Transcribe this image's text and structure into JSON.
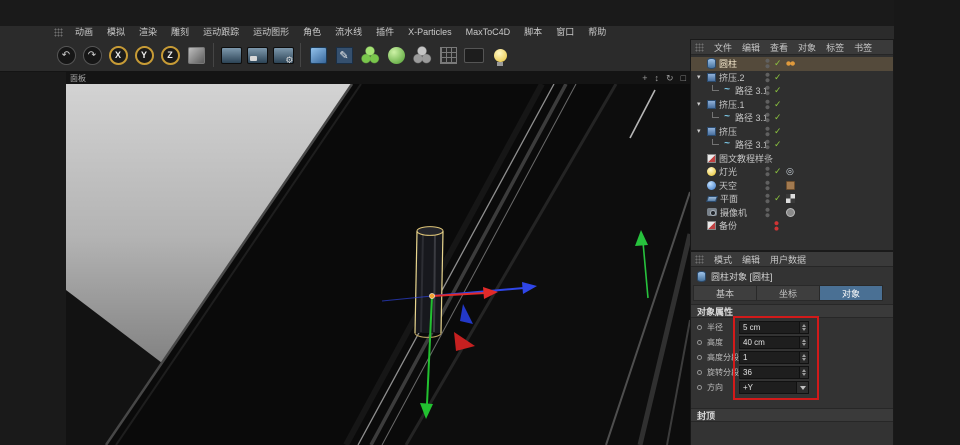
{
  "menubar": {
    "items": [
      "动画",
      "模拟",
      "渲染",
      "雕刻",
      "运动跟踪",
      "运动图形",
      "角色",
      "流水线",
      "插件",
      "X-Particles",
      "MaxToC4D",
      "脚本",
      "窗口",
      "帮助"
    ]
  },
  "toolbar": {
    "axis_lock": [
      "X",
      "Y",
      "Z"
    ]
  },
  "viewport": {
    "panel_label": "面板"
  },
  "object_manager": {
    "menu": [
      "文件",
      "编辑",
      "查看",
      "对象",
      "标签",
      "书签"
    ],
    "items": [
      {
        "label": "圆柱",
        "icon": "cylinder-icon",
        "selected": true
      },
      {
        "label": "挤压.2",
        "icon": "extrude-icon"
      },
      {
        "label": "路径 3.1",
        "icon": "spline-icon"
      },
      {
        "label": "挤压.1",
        "icon": "extrude-icon"
      },
      {
        "label": "路径 3.1",
        "icon": "spline-icon"
      },
      {
        "label": "挤压",
        "icon": "extrude-icon"
      },
      {
        "label": "路径 3.1",
        "icon": "spline-icon"
      },
      {
        "label": "图文教程样条",
        "icon": "null-icon"
      },
      {
        "label": "灯光",
        "icon": "light-icon"
      },
      {
        "label": "天空",
        "icon": "sky-icon"
      },
      {
        "label": "平面",
        "icon": "plane-icon"
      },
      {
        "label": "摄像机",
        "icon": "camera-icon"
      },
      {
        "label": "备份",
        "icon": "null-icon"
      }
    ]
  },
  "attribute_manager": {
    "menu": [
      "模式",
      "编辑",
      "用户数据"
    ],
    "object_title": "圆柱对象 [圆柱]",
    "tabs": [
      "基本",
      "坐标",
      "对象"
    ],
    "active_tab": "对象",
    "section_title": "对象属性",
    "fields": [
      {
        "label": "半径",
        "value": "5 cm"
      },
      {
        "label": "高度",
        "value": "40 cm"
      },
      {
        "label": "高度分段",
        "value": "1"
      },
      {
        "label": "旋转分段",
        "value": "36"
      },
      {
        "label": "方向",
        "value": "+Y"
      }
    ],
    "footer_section": "封顶",
    "highlight_color": "#d21a1a"
  },
  "icons": {
    "undo": "↶",
    "redo": "↷",
    "pen": "✎",
    "check": "✓",
    "expand": "▾",
    "pan": "+",
    "zoom": "↕",
    "rotate": "↻",
    "maximize": "□",
    "target": "◎"
  },
  "colors": {
    "active_tab_blue": "#4a7094",
    "check_green": "#8dc63f",
    "tag_orange": "#e09a3c"
  }
}
